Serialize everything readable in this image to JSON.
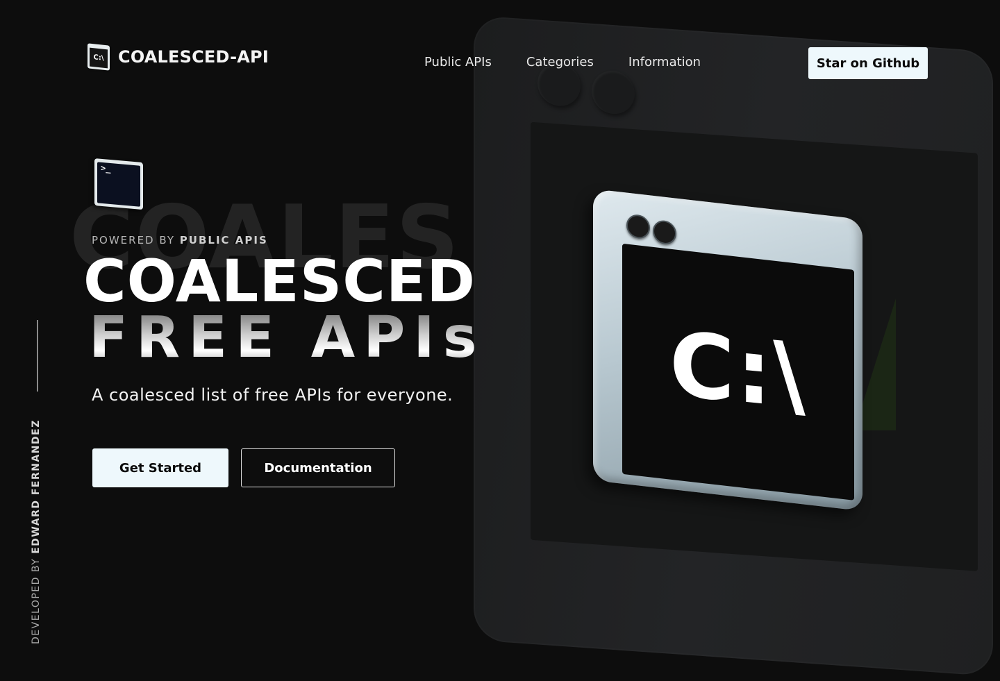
{
  "header": {
    "brand_icon_text": "C:\\",
    "brand_name": "COALESCED-API",
    "nav": [
      {
        "label": "Public APIs"
      },
      {
        "label": "Categories"
      },
      {
        "label": "Information"
      }
    ],
    "github_button": "Star on Github"
  },
  "hero": {
    "ghost_word": "COALES",
    "mini_terminal_prompt": ">_",
    "powered_prefix": "POWERED BY",
    "powered_name": "PUBLIC APIS",
    "title": "COALESCED",
    "subtitle": "FREE APIs",
    "tagline": "A coalesced list of free APIs for everyone.",
    "primary_button": "Get Started",
    "secondary_button": "Documentation"
  },
  "illustration": {
    "terminal_text": "C:\\"
  },
  "side": {
    "credit_prefix": "DEVELOPED BY",
    "credit_name": "EDWARD FERNANDEZ"
  },
  "colors": {
    "background": "#0d0d0d",
    "button_light": "#eef8fc",
    "text": "#ffffff"
  }
}
